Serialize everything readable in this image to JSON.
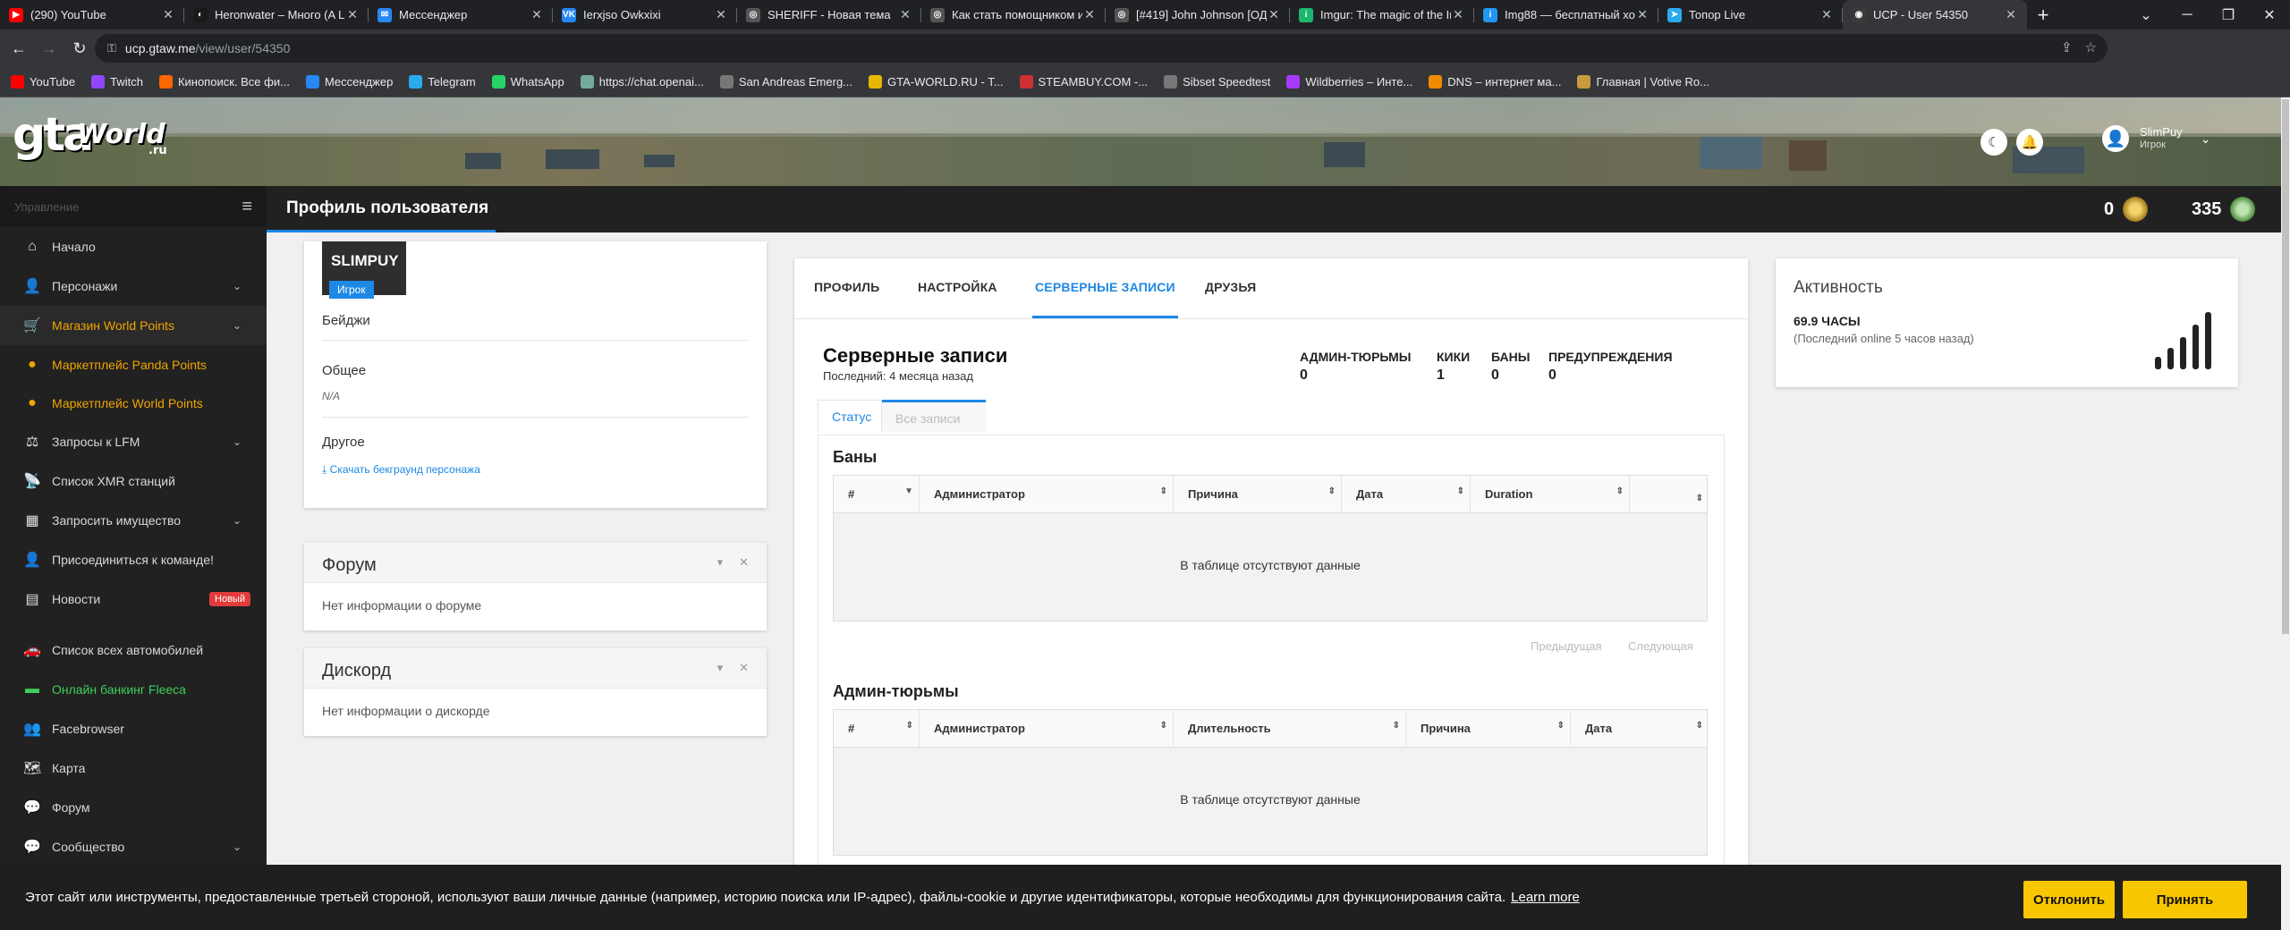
{
  "browser": {
    "tabs": [
      {
        "title": "(290) YouTube",
        "color": "#ff0000",
        "glyph": "▶"
      },
      {
        "title": "Heronwater – Много (A L",
        "color": "#1a1a1a",
        "glyph": "◐"
      },
      {
        "title": "Мессенджер",
        "color": "#2787f5",
        "glyph": "✉"
      },
      {
        "title": "Ierxjso Owkxixi",
        "color": "#2787f5",
        "glyph": "VK"
      },
      {
        "title": "SHERIFF - Новая тема",
        "color": "#555555",
        "glyph": "◎"
      },
      {
        "title": "Как стать помощником и",
        "color": "#555555",
        "glyph": "◎"
      },
      {
        "title": "[#419] John Johnson [ОД",
        "color": "#555555",
        "glyph": "◎"
      },
      {
        "title": "Imgur: The magic of the In",
        "color": "#1bb76e",
        "glyph": "i"
      },
      {
        "title": "Img88 — бесплатный хос",
        "color": "#2196f3",
        "glyph": "i"
      },
      {
        "title": "Топор Live",
        "color": "#2aabee",
        "glyph": "➤"
      },
      {
        "title": "UCP - User 54350",
        "color": "#3a3a3a",
        "glyph": "◉"
      }
    ],
    "url_host": "ucp.gtaw.me",
    "url_path": "/view/user/54350",
    "bookmarks": [
      {
        "label": "YouTube",
        "color": "#ff0000"
      },
      {
        "label": "Twitch",
        "color": "#9146ff"
      },
      {
        "label": "Кинопоиск. Все фи...",
        "color": "#ff6600"
      },
      {
        "label": "Мессенджер",
        "color": "#2787f5"
      },
      {
        "label": "Telegram",
        "color": "#2aabee"
      },
      {
        "label": "WhatsApp",
        "color": "#25d366"
      },
      {
        "label": "https://chat.openai...",
        "color": "#74aa9c"
      },
      {
        "label": "San Andreas Emerg...",
        "color": "#777777"
      },
      {
        "label": "GTA-WORLD.RU - T...",
        "color": "#e6b800"
      },
      {
        "label": "STEAMBUY.COM -...",
        "color": "#d03030"
      },
      {
        "label": "Sibset Speedtest",
        "color": "#777777"
      },
      {
        "label": "Wildberries – Инте...",
        "color": "#a73afd"
      },
      {
        "label": "DNS – интернет ма...",
        "color": "#f08a00"
      },
      {
        "label": "Главная | Votive Ro...",
        "color": "#c89b3c"
      }
    ]
  },
  "header": {
    "logo_main": "gta",
    "logo_world": "World",
    "logo_ru": ".ru",
    "user_name": "SlimPuy",
    "user_role": "Игрок"
  },
  "sidebar": {
    "section_label": "Управление",
    "items": [
      {
        "label": "Начало",
        "icon": "home-icon",
        "glyph": "⌂"
      },
      {
        "label": "Персонажи",
        "icon": "user-icon",
        "glyph": "👤",
        "chevron": true
      },
      {
        "label": "Магазин World Points",
        "icon": "cart-icon",
        "glyph": "🛒",
        "chevron": true
      },
      {
        "label": "Маркетплейс Panda Points",
        "icon": "coins-icon",
        "glyph": "●"
      },
      {
        "label": "Маркетплейс World Points",
        "icon": "coins-icon",
        "glyph": "●"
      },
      {
        "label": "Запросы к LFM",
        "icon": "scale-icon",
        "glyph": "⚖",
        "chevron": true
      },
      {
        "label": "Список XMR станций",
        "icon": "antenna-icon",
        "glyph": "📡"
      },
      {
        "label": "Запросить имущество",
        "icon": "building-icon",
        "glyph": "▦",
        "chevron": true
      },
      {
        "label": "Присоединиться к команде!",
        "icon": "user-plus-icon",
        "glyph": "👤"
      },
      {
        "label": "Новости",
        "icon": "newspaper-icon",
        "glyph": "▤",
        "badge": "Новый"
      },
      {
        "label": "Список всех автомобилей",
        "icon": "car-icon",
        "glyph": "🚗"
      },
      {
        "label": "Онлайн банкинг Fleeca",
        "icon": "bank-icon",
        "glyph": "▬"
      },
      {
        "label": "Facebrowser",
        "icon": "users-icon",
        "glyph": "👥"
      },
      {
        "label": "Карта",
        "icon": "map-icon",
        "glyph": "🗺"
      },
      {
        "label": "Форум",
        "icon": "chat-icon",
        "glyph": "💬"
      },
      {
        "label": "Сообщество",
        "icon": "community-icon",
        "glyph": "💬",
        "chevron": true
      }
    ]
  },
  "page": {
    "title": "Профиль пользователя",
    "points_a": "0",
    "points_b": "335"
  },
  "profile": {
    "username": "SLIMPUY",
    "role": "Игрок",
    "badges_label": "Бейджи",
    "general_label": "Общее",
    "general_value": "N/A",
    "other_label": "Другое",
    "download_link": "Скачать бекграунд персонажа"
  },
  "forum_card": {
    "title": "Форум",
    "body": "Нет информации о форуме"
  },
  "discord_card": {
    "title": "Дискорд",
    "body": "Нет информации о дискорде"
  },
  "main": {
    "tabs": [
      "ПРОФИЛЬ",
      "НАСТРОЙКА",
      "СЕРВЕРНЫЕ ЗАПИСИ",
      "ДРУЗЬЯ"
    ],
    "active_tab": "СЕРВЕРНЫЕ ЗАПИСИ",
    "records_title": "Серверные записи",
    "records_sub": "Последний: 4 месяца назад",
    "stats": [
      {
        "label": "АДМИН-ТЮРЬМЫ",
        "value": "0"
      },
      {
        "label": "КИКИ",
        "value": "1"
      },
      {
        "label": "БАНЫ",
        "value": "0"
      },
      {
        "label": "ПРЕДУПРЕЖДЕНИЯ",
        "value": "0"
      }
    ],
    "subtabs": [
      "Статус",
      "Все записи"
    ],
    "bans": {
      "title": "Баны",
      "columns": [
        "#",
        "Администратор",
        "Причина",
        "Дата",
        "Duration",
        ""
      ],
      "empty": "В таблице отсутствуют данные",
      "prev": "Предыдущая",
      "next": "Следующая"
    },
    "jails": {
      "title": "Админ-тюрьмы",
      "columns": [
        "#",
        "Администратор",
        "Длительность",
        "Причина",
        "Дата"
      ],
      "empty": "В таблице отсутствуют данные"
    }
  },
  "activity": {
    "title": "Активность",
    "hours": "69.9 ЧАСЫ",
    "last_online": "(Последний online 5 часов назад)"
  },
  "cookie": {
    "text": "Этот сайт или инструменты, предоставленные третьей стороной, используют ваши личные данные (например, историю поиска или IP-адрес), файлы-cookie и другие идентификаторы, которые необходимы для функционирования сайта.",
    "learn_more": "Learn more",
    "decline": "Отклонить",
    "accept": "Принять"
  },
  "colors": {
    "accent": "#1e88e5",
    "gold": "#f0a500",
    "green": "#3ecf5a",
    "cookie_btn": "#f7c600"
  }
}
